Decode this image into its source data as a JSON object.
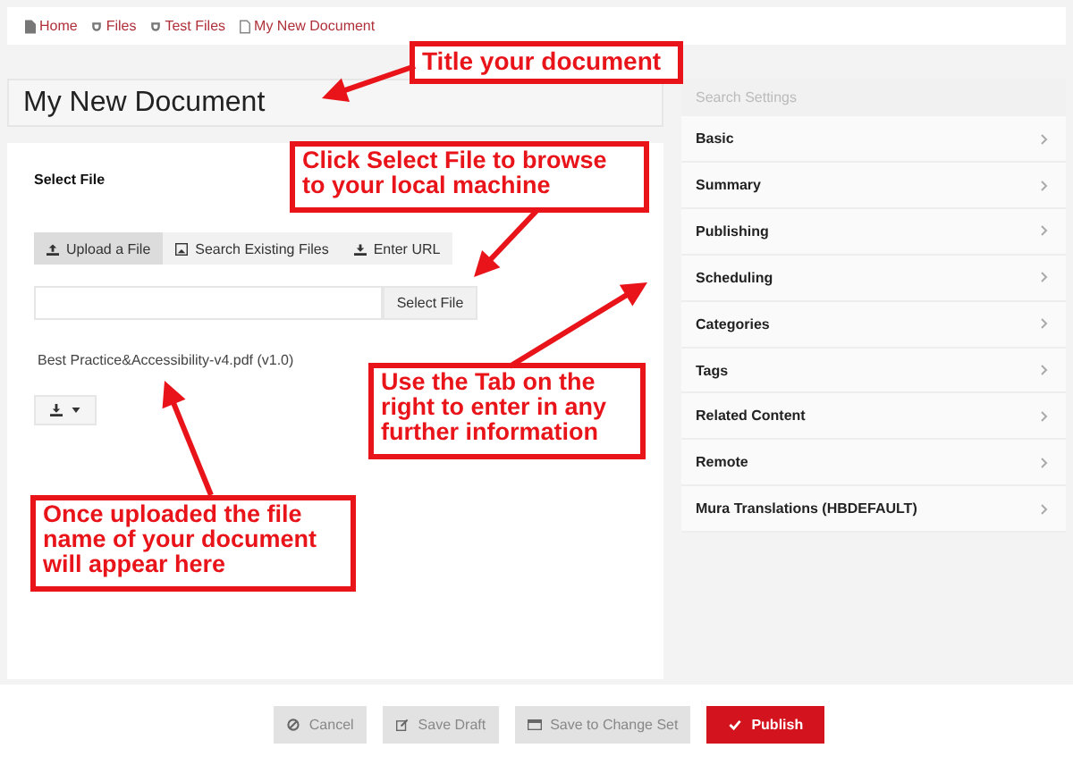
{
  "breadcrumb": [
    {
      "label": "Home",
      "kind": "page"
    },
    {
      "label": "Files",
      "kind": "folder"
    },
    {
      "label": "Test Files",
      "kind": "folder"
    },
    {
      "label": "My New Document",
      "kind": "file"
    }
  ],
  "title_field": {
    "value": "My New Document"
  },
  "file_section": {
    "label": "Select File",
    "tabs": [
      {
        "label": "Upload a File",
        "kind": "upload",
        "selected": true
      },
      {
        "label": "Search Existing Files",
        "kind": "image",
        "selected": false
      },
      {
        "label": "Enter URL",
        "kind": "download",
        "selected": false
      }
    ],
    "select_button": "Select File",
    "file_name": "Best Practice&Accessibility-v4.pdf (v1.0)"
  },
  "settings": {
    "search_placeholder": "Search Settings",
    "items": [
      {
        "label": "Basic"
      },
      {
        "label": "Summary"
      },
      {
        "label": "Publishing"
      },
      {
        "label": "Scheduling"
      },
      {
        "label": "Categories"
      },
      {
        "label": "Tags"
      },
      {
        "label": "Related Content"
      },
      {
        "label": "Remote"
      },
      {
        "label": "Mura Translations (HBDEFAULT)"
      }
    ]
  },
  "footer_buttons": [
    {
      "label": "Cancel",
      "kind": "cancel"
    },
    {
      "label": "Save Draft",
      "kind": "draft"
    },
    {
      "label": "Save to Change Set",
      "kind": "changeset"
    },
    {
      "label": "Publish",
      "kind": "publish"
    }
  ],
  "annotations": [
    "Title your document",
    "Click Select File to browse to your local machine",
    "Use the Tab on the right to enter in any further information",
    "Once uploaded the file name of your document will appear here"
  ]
}
